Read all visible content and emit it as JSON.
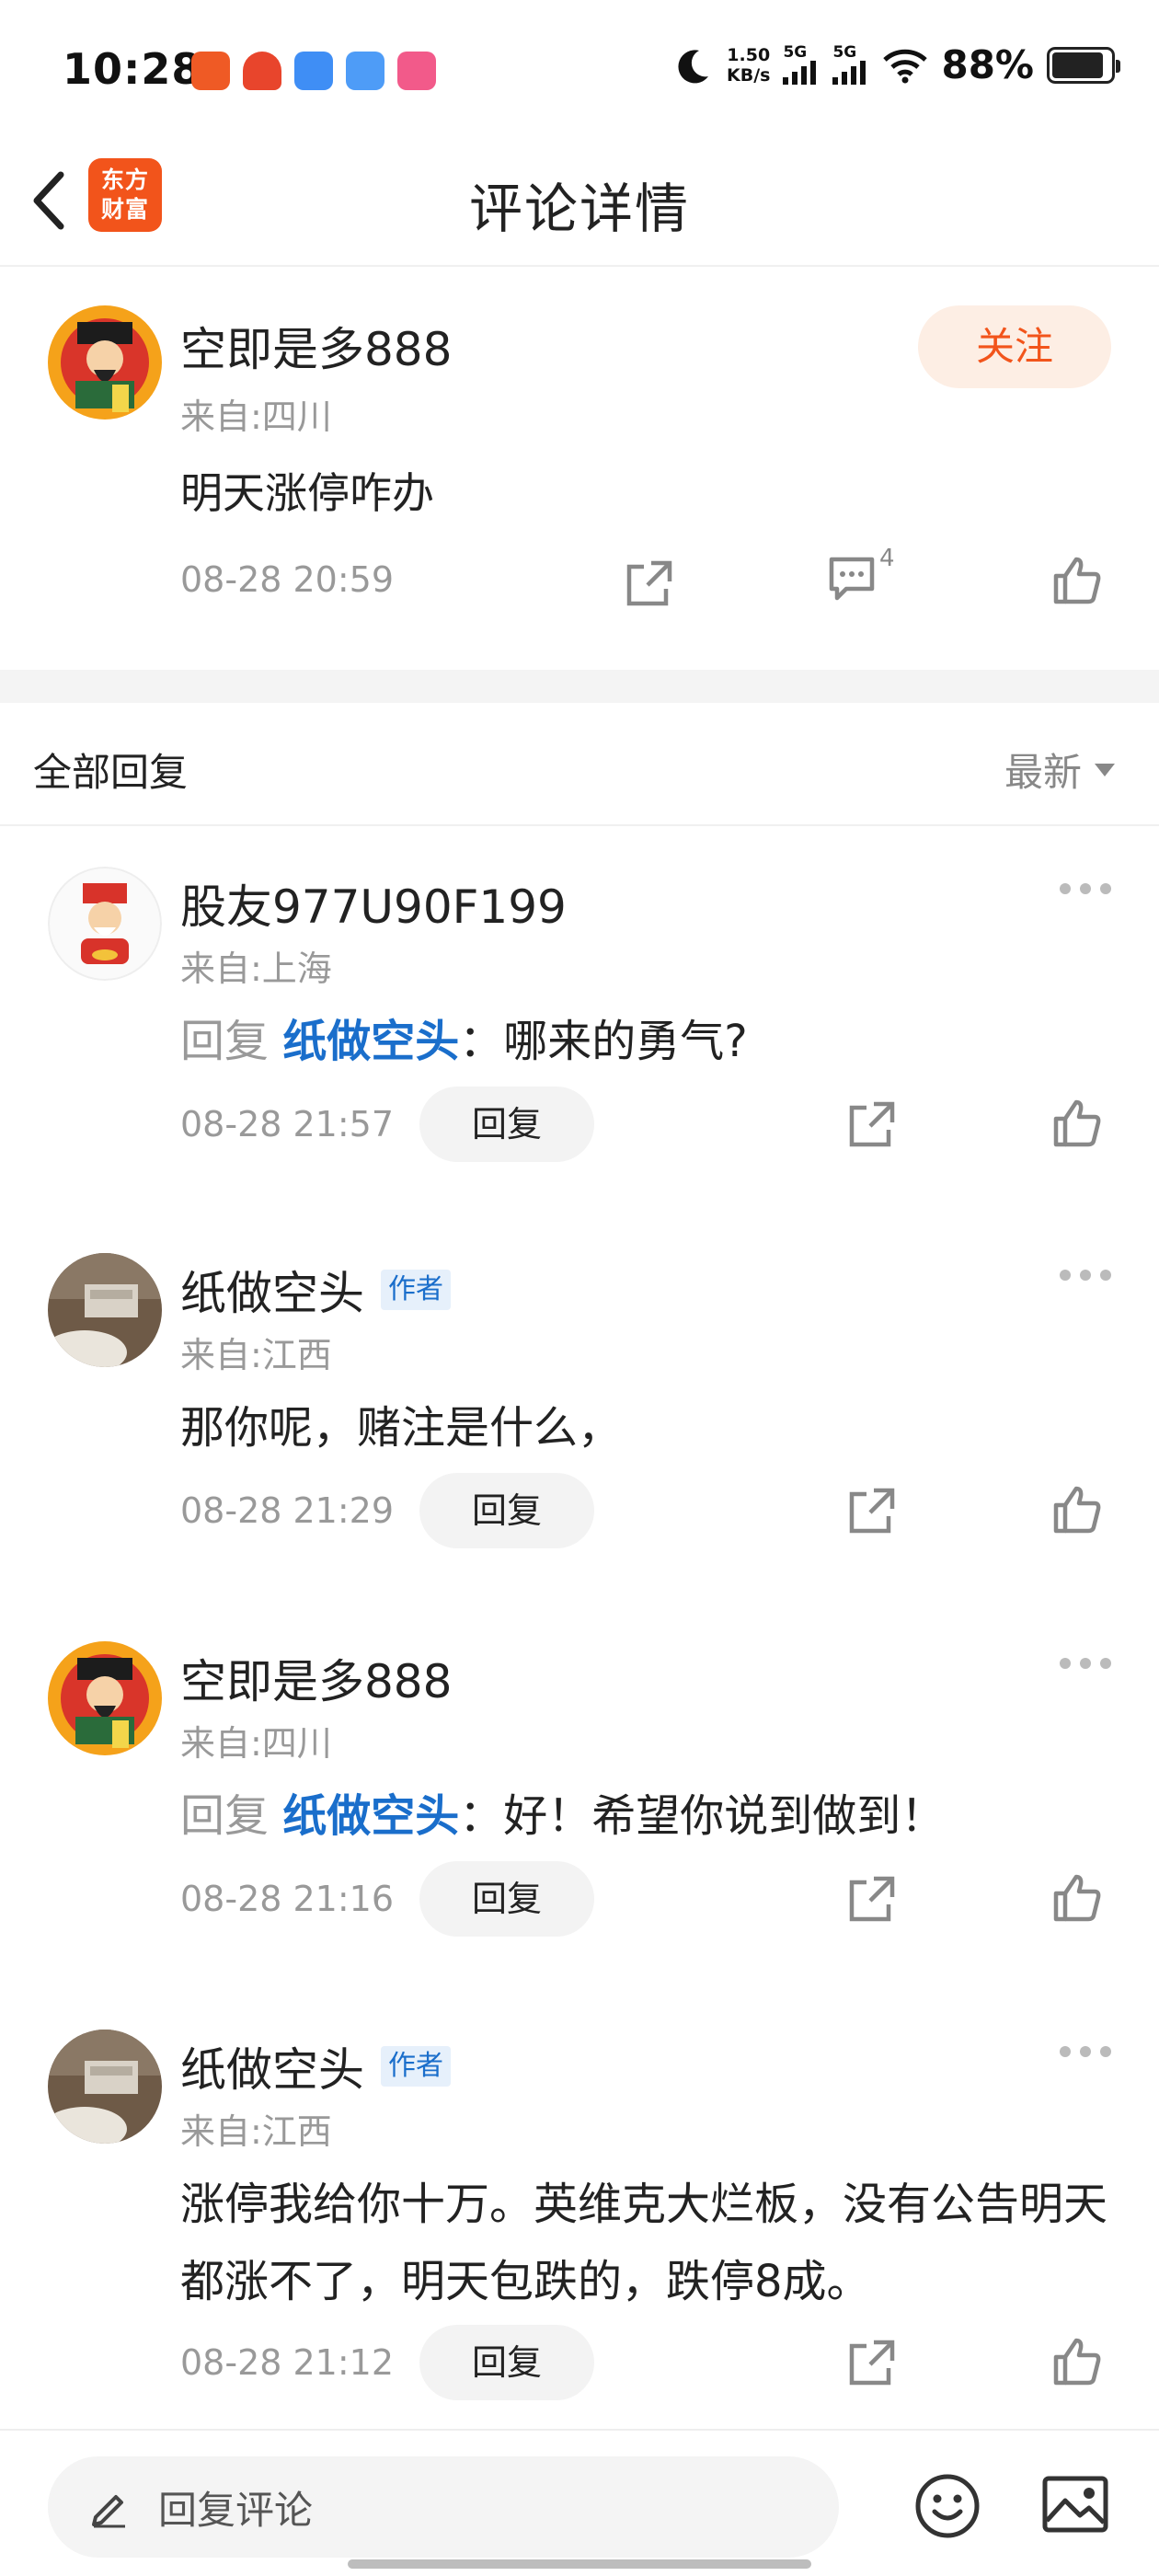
{
  "status_bar": {
    "time": "10:28",
    "net_speed_value": "1.50",
    "net_speed_unit": "KB/s",
    "sig1_label": "5G",
    "sig2_label": "5G",
    "battery": "88%",
    "battery_level": 0.88
  },
  "nav": {
    "logo_line1": "东方",
    "logo_line2": "财富",
    "title": "评论详情"
  },
  "post": {
    "username": "空即是多888",
    "location": "来自:四川",
    "text": "明天涨停咋办",
    "time": "08-28 20:59",
    "comment_count": "4",
    "follow_label": "关注"
  },
  "reply_header": {
    "title": "全部回复",
    "sort_label": "最新"
  },
  "replies": [
    {
      "username": "股友977U90F199",
      "location": "来自:上海",
      "reply_prefix": "回复 ",
      "mention": "纸做空头",
      "separator": "：",
      "text": "哪来的勇气?",
      "time": "08-28 21:57",
      "reply_label": "回复"
    },
    {
      "username": "纸做空头",
      "badge": "作者",
      "location": "来自:江西",
      "text": "那你呢，赌注是什么，",
      "time": "08-28 21:29",
      "reply_label": "回复"
    },
    {
      "username": "空即是多888",
      "location": "来自:四川",
      "reply_prefix": "回复 ",
      "mention": "纸做空头",
      "separator": "：",
      "text": "好！希望你说到做到！",
      "time": "08-28 21:16",
      "reply_label": "回复"
    },
    {
      "username": "纸做空头",
      "badge": "作者",
      "location": "来自:江西",
      "text": "涨停我给你十万。英维克大烂板，没有公告明天都涨不了，明天包跌的，跌停8成。",
      "time": "08-28 21:12",
      "reply_label": "回复"
    }
  ],
  "bottom_bar": {
    "input_placeholder": "回复评论"
  },
  "colors": {
    "accent_orange": "#f2541b",
    "link_blue": "#1a6ecb",
    "muted_gray": "#999999"
  }
}
